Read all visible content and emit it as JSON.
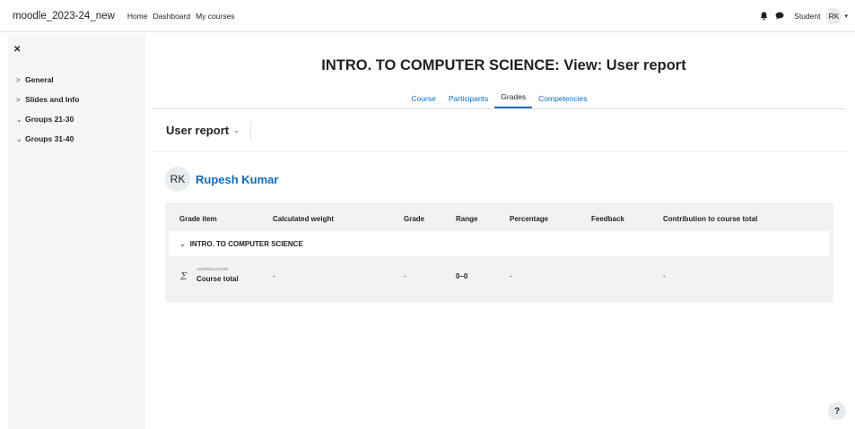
{
  "navbar": {
    "site_name": "moodle_2023-24_new",
    "links": [
      "Home",
      "Dashboard",
      "My courses"
    ],
    "role": "Student",
    "user_initials": "RK"
  },
  "drawer": {
    "items": [
      {
        "label": "General",
        "expanded": false
      },
      {
        "label": "Slides and Info",
        "expanded": false
      },
      {
        "label": "Groups 21-30",
        "expanded": true
      },
      {
        "label": "Groups 31-40",
        "expanded": true
      }
    ]
  },
  "page": {
    "title": "INTRO. TO COMPUTER SCIENCE: View: User report",
    "tabs": [
      "Course",
      "Participants",
      "Grades",
      "Competencies"
    ],
    "active_tab": "Grades",
    "report_selector": "User report"
  },
  "student": {
    "initials": "RK",
    "name": "Rupesh Kumar"
  },
  "grade_table": {
    "headers": [
      "Grade item",
      "Calculated weight",
      "Grade",
      "Range",
      "Percentage",
      "Feedback",
      "Contribution to course total"
    ],
    "category": "INTRO. TO COMPUTER SCIENCE",
    "total_row": {
      "aggregation_label": "AGGREGATION",
      "item": "Course total",
      "weight": "-",
      "grade": "-",
      "range": "0–0",
      "percentage": "-",
      "feedback": "",
      "contribution": "-"
    }
  },
  "help": {
    "label": "?"
  },
  "colors": {
    "accent": "#0f6cbf",
    "drawer_bg": "#f5f6f7",
    "table_bg": "#f1f2f3"
  }
}
